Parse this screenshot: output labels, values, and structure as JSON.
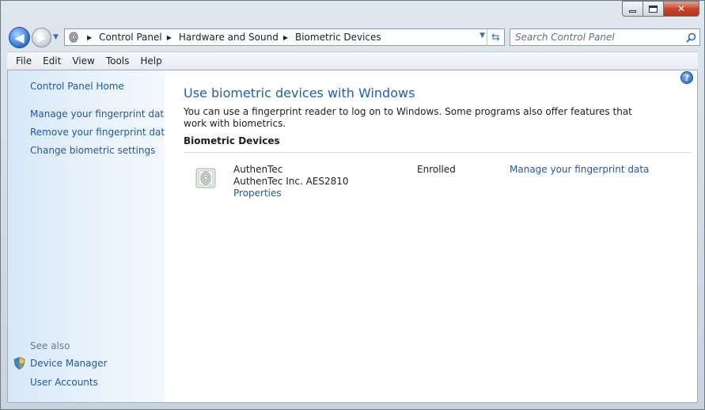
{
  "window": {
    "controls": {
      "minimize": "minimize",
      "maximize": "maximize",
      "close": "close"
    }
  },
  "nav": {
    "breadcrumbs": [
      "Control Panel",
      "Hardware and Sound",
      "Biometric Devices"
    ],
    "search_placeholder": "Search Control Panel"
  },
  "menu": {
    "items": [
      "File",
      "Edit",
      "View",
      "Tools",
      "Help"
    ]
  },
  "sidebar": {
    "home": "Control Panel Home",
    "tasks": [
      "Manage your fingerprint data",
      "Remove your fingerprint data",
      "Change biometric settings"
    ],
    "see_also_label": "See also",
    "see_also": [
      "Device Manager",
      "User Accounts"
    ]
  },
  "main": {
    "title": "Use biometric devices with Windows",
    "description": "You can use a fingerprint reader to log on to Windows. Some programs also offer features that work with biometrics.",
    "section_heading": "Biometric Devices",
    "device": {
      "name": "AuthenTec",
      "model": "AuthenTec Inc. AES2810",
      "properties_link": "Properties",
      "status": "Enrolled",
      "manage_link": "Manage your fingerprint data"
    }
  },
  "colors": {
    "link": "#1e59a8",
    "title": "#1f5fb5",
    "sidebar_bg": "#d6e8f7",
    "close_button": "#c9452b"
  }
}
